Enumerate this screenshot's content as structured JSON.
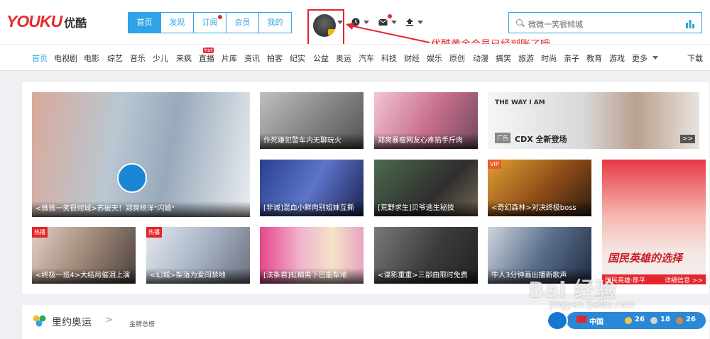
{
  "logo": {
    "wordmark": "YOUKU",
    "chinese": "优酷"
  },
  "main_nav": [
    {
      "label": "首页",
      "active": true
    },
    {
      "label": "发现"
    },
    {
      "label": "订阅",
      "dot": true
    },
    {
      "label": "会员"
    },
    {
      "label": "我的"
    }
  ],
  "header_icons": [
    "history-clock-icon",
    "mail-icon",
    "upload-icon"
  ],
  "search": {
    "placeholder": "微微一笑很倾城"
  },
  "annotation": "优酷黄金会员已经到账了哦",
  "channels": [
    "首页",
    "电视剧",
    "电影",
    "综艺",
    "音乐",
    "少儿",
    "来疯",
    "直播",
    "片库",
    "资讯",
    "拍客",
    "纪实",
    "公益",
    "奥运",
    "汽车",
    "科技",
    "财经",
    "娱乐",
    "原创",
    "动漫",
    "搞笑",
    "旅游",
    "时尚",
    "亲子",
    "教育",
    "游戏",
    "更多",
    "下载"
  ],
  "hot_badge": "hot",
  "tiles": [
    {
      "caption": "<微微一笑很倾城>苏破天！郑爽杨洋\"闪婚\"",
      "tag": ""
    },
    {
      "caption": "作死嫌犯警车内无聊玩火",
      "tag": ""
    },
    {
      "caption": "郑爽暴瘦网友心疼掐手斤肉",
      "tag": ""
    },
    {
      "caption": "",
      "tag": "广告",
      "ad_text": "THE WAY I AM",
      "ad_brand": "CDX 全新登场",
      "ad_more": ">>"
    },
    {
      "caption": "[非诚]混血小鲜肉别姐妹互撕",
      "tag": ""
    },
    {
      "caption": "[荒野求生]贝爷逃生秘技",
      "tag": ""
    },
    {
      "caption": "<奇幻森林>对决终极boss",
      "tag": "VIP"
    },
    {
      "caption": "国民英雄·郎平",
      "tag": "",
      "side_text": "国民英雄的选择",
      "detail": "详细信息 >>"
    },
    {
      "caption": "<终极一班4>大结局催泪上演",
      "tag": "热播"
    },
    {
      "caption": "<幻城>梨落为爱闯禁地",
      "tag": "热播"
    },
    {
      "caption": "[法条君]虹精男下巴能犁地",
      "tag": ""
    },
    {
      "caption": "<谍影重重>三部曲限时免费",
      "tag": ""
    },
    {
      "caption": "牛人3分钟画出播新歌声",
      "tag": ""
    }
  ],
  "section": {
    "title": "里约奥运",
    "chevron": ">",
    "subtitle": "金牌总榜"
  },
  "medals": {
    "china_label": "中国",
    "gold": "26",
    "silver": "18",
    "bronze": "26"
  },
  "watermark": {
    "main": "Bai 经验",
    "sub": "jingyan.baidu.com"
  },
  "colors": {
    "accent": "#2fa3e6",
    "brand_red": "#e52b2c",
    "annotation_red": "#e4262b"
  }
}
